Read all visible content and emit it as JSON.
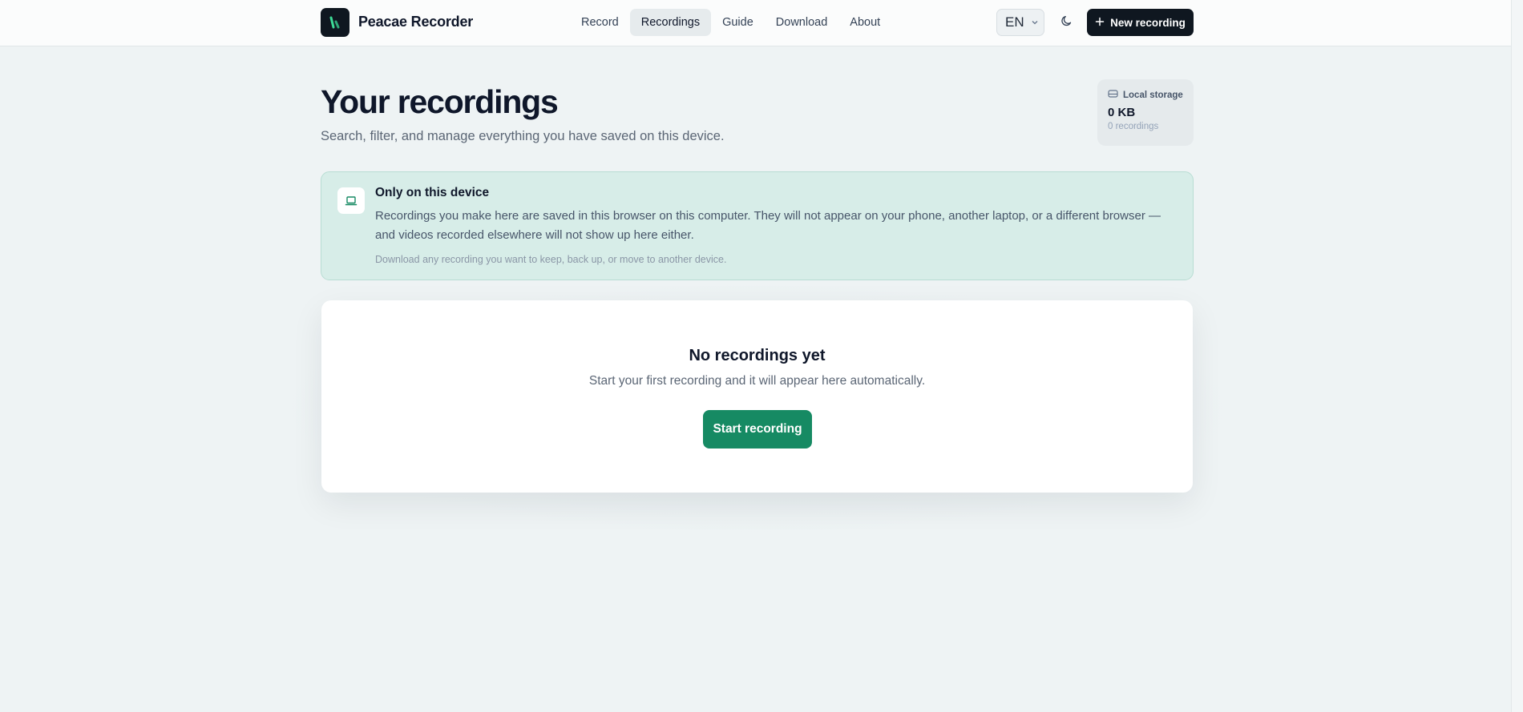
{
  "header": {
    "brand": "Peacae Recorder",
    "nav": [
      {
        "label": "Record",
        "active": false
      },
      {
        "label": "Recordings",
        "active": true
      },
      {
        "label": "Guide",
        "active": false
      },
      {
        "label": "Download",
        "active": false
      },
      {
        "label": "About",
        "active": false
      }
    ],
    "language": "EN",
    "new_recording_label": "New recording"
  },
  "main": {
    "title": "Your recordings",
    "subtitle": "Search, filter, and manage everything you have saved on this device."
  },
  "storage": {
    "label": "Local storage",
    "size": "0 KB",
    "count": "0 recordings"
  },
  "info": {
    "title": "Only on this device",
    "body": "Recordings you make here are saved in this browser on this computer. They will not appear on your phone, another laptop, or a different browser — and videos recorded elsewhere will not show up here either.",
    "note": "Download any recording you want to keep, back up, or move to another device."
  },
  "empty_state": {
    "title": "No recordings yet",
    "subtitle": "Start your first recording and it will appear here automatically.",
    "button_label": "Start recording"
  },
  "colors": {
    "accent": "#168a63",
    "dark": "#0f1720",
    "banner": "#d7ede8"
  },
  "icons": [
    "logo-icon",
    "chevron-down-icon",
    "moon-icon",
    "plus-icon",
    "hard-drive-icon",
    "laptop-icon"
  ]
}
